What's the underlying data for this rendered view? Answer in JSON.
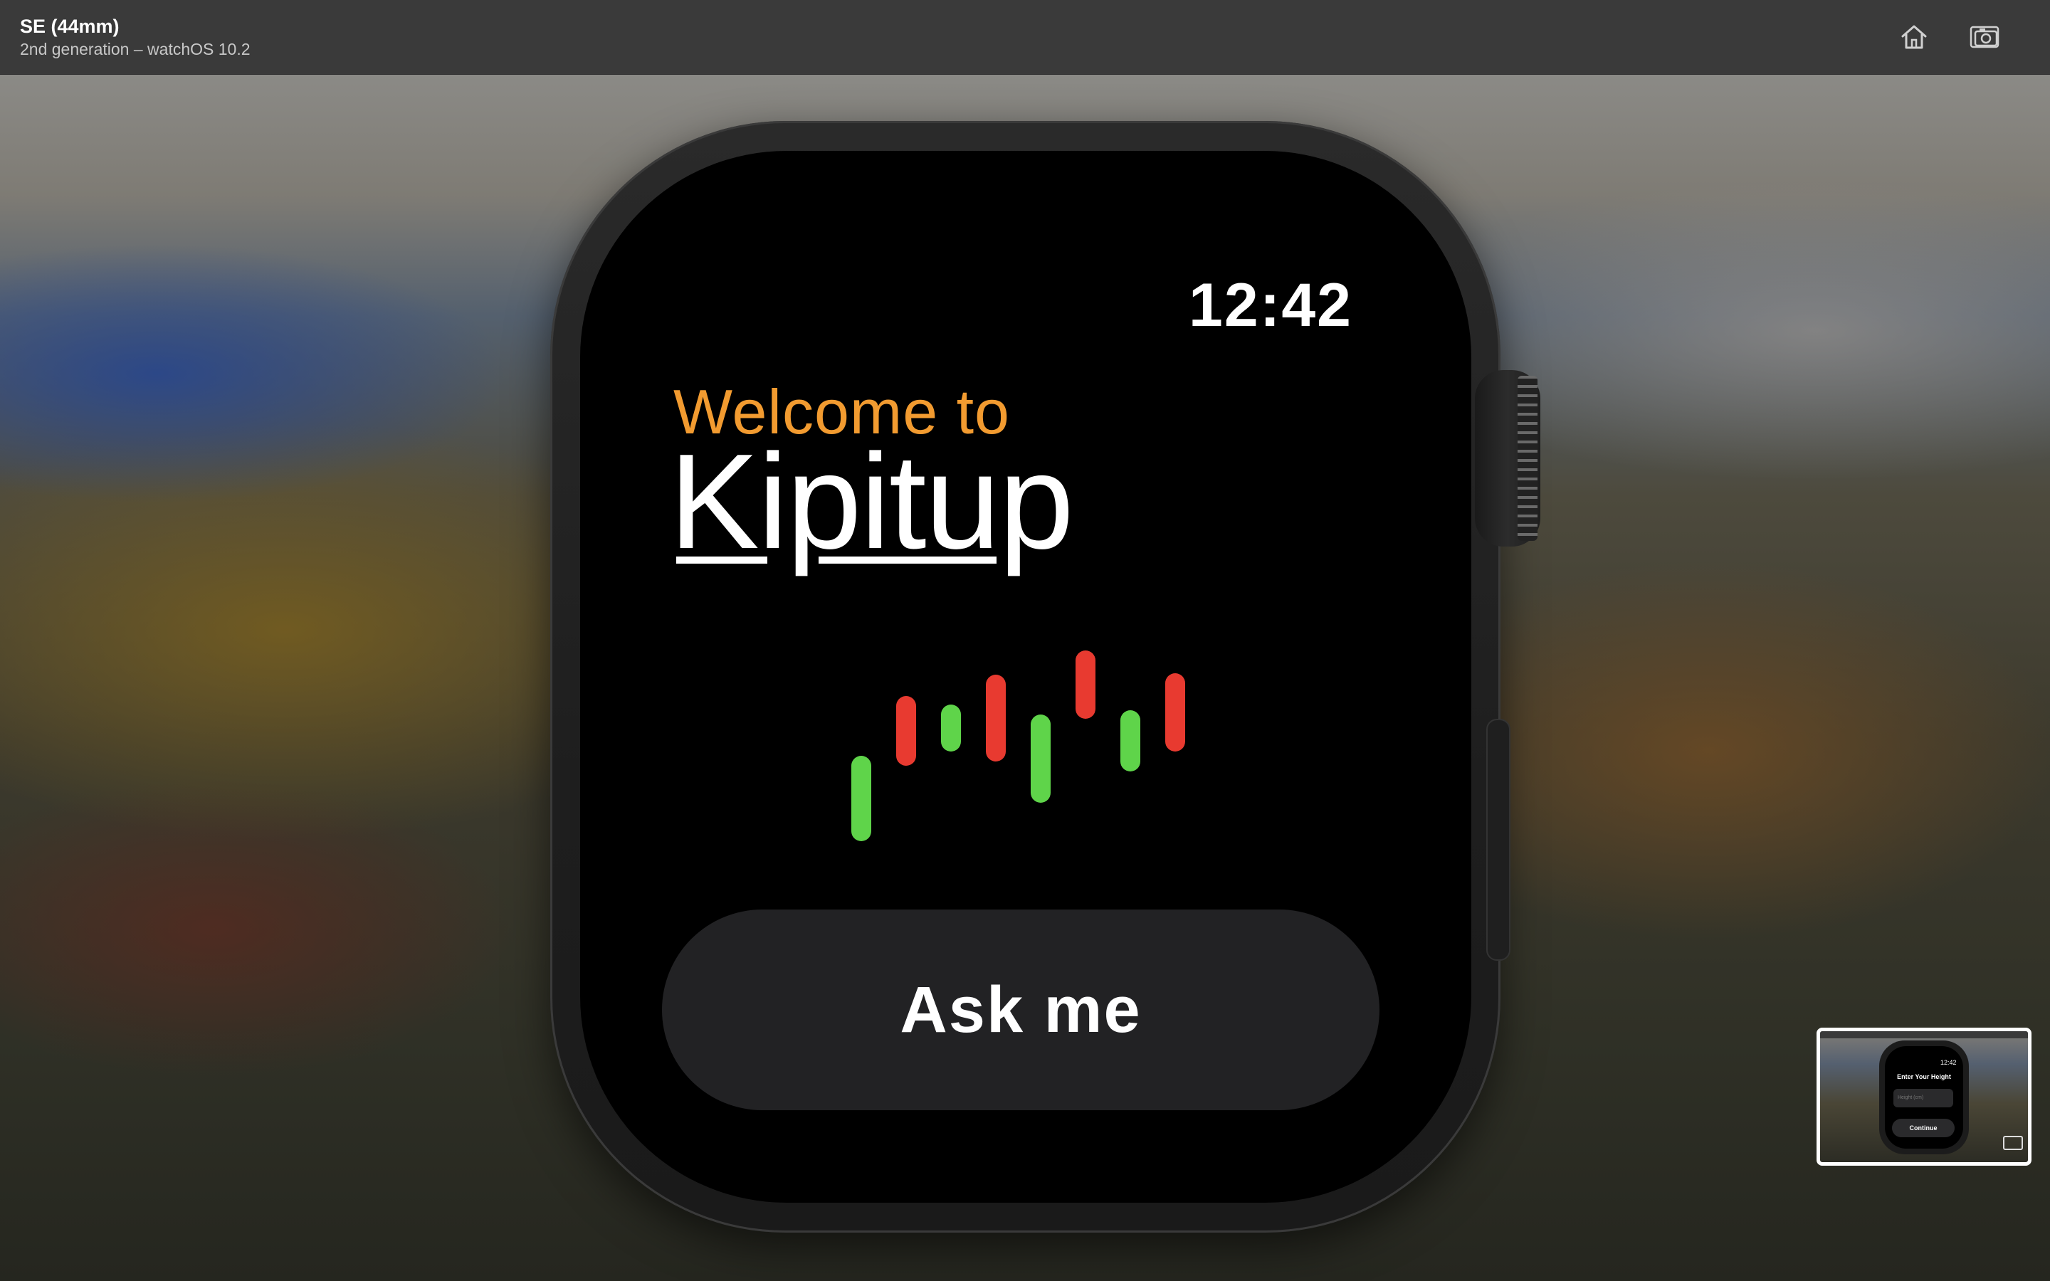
{
  "window": {
    "title": "SE (44mm)",
    "subtitle": "2nd generation – watchOS 10.2",
    "home_icon": "home-icon",
    "screenshot_icon": "screenshot-camera-icon"
  },
  "watch_screen": {
    "time": "12:42",
    "welcome_text": "Welcome to",
    "app_name": "Kipitup",
    "action_button_label": "Ask me"
  },
  "logo_bars": {
    "colors": {
      "green": "#5fd44a",
      "red": "#e83a30"
    },
    "bars": [
      {
        "color": "green"
      },
      {
        "color": "red"
      },
      {
        "color": "green"
      },
      {
        "color": "red"
      },
      {
        "color": "green"
      },
      {
        "color": "red"
      },
      {
        "color": "green"
      },
      {
        "color": "red"
      }
    ]
  },
  "thumbnail": {
    "time": "12:42",
    "heading": "Enter Your Height",
    "field_placeholder": "Height (cm)",
    "button_label": "Continue"
  },
  "colors": {
    "accent_orange": "#f29b30",
    "button_background": "#222224",
    "screen_background": "#000000"
  }
}
